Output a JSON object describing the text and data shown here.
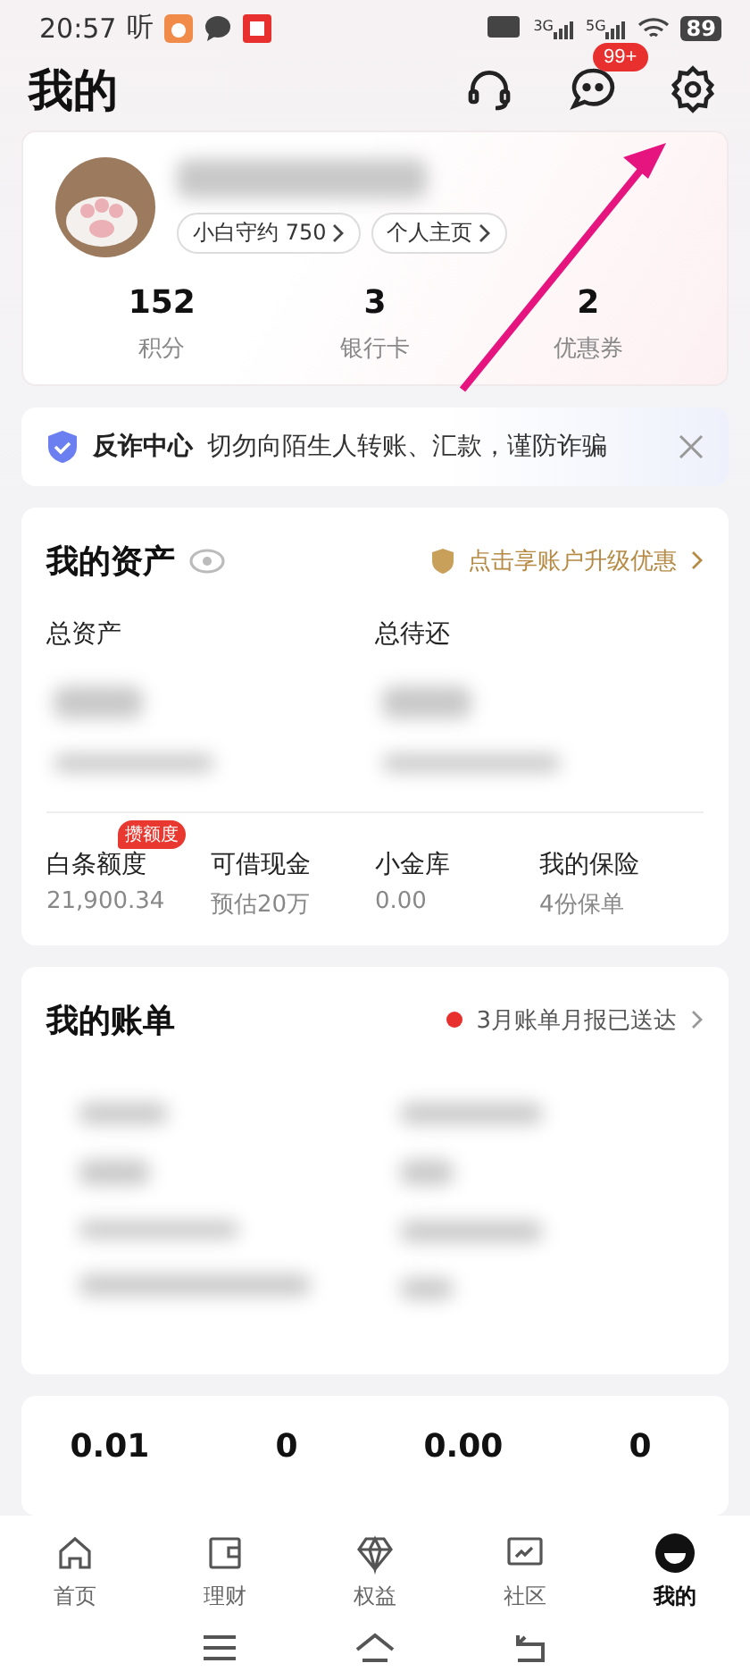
{
  "status_bar": {
    "time": "20:57",
    "notifications": [
      "听"
    ],
    "battery": "89",
    "network": [
      "3G",
      "5G"
    ]
  },
  "header": {
    "title": "我的",
    "message_badge": "99+"
  },
  "profile": {
    "tags": [
      "小白守约 750",
      "个人主页"
    ],
    "stats": [
      {
        "value": "152",
        "label": "积分"
      },
      {
        "value": "3",
        "label": "银行卡"
      },
      {
        "value": "2",
        "label": "优惠券"
      }
    ]
  },
  "notice": {
    "title": "反诈中心",
    "text": "切勿向陌生人转账、汇款，谨防诈骗"
  },
  "assets": {
    "title": "我的资产",
    "promo": "点击享账户升级优惠",
    "totals": [
      "总资产",
      "总待还"
    ],
    "items": [
      {
        "label": "白条额度",
        "value": "21,900.34",
        "badge": "攒额度"
      },
      {
        "label": "可借现金",
        "value": "预估20万"
      },
      {
        "label": "小金库",
        "value": "0.00"
      },
      {
        "label": "我的保险",
        "value": "4份保单"
      }
    ]
  },
  "bills": {
    "title": "我的账单",
    "notice": "3月账单月报已送达"
  },
  "balances": [
    {
      "value": "0.01"
    },
    {
      "value": "0"
    },
    {
      "value": "0.00"
    },
    {
      "value": "0"
    }
  ],
  "tab_bar": [
    {
      "label": "首页",
      "selected": false,
      "kind": "home"
    },
    {
      "label": "理财",
      "selected": false,
      "kind": "wallet"
    },
    {
      "label": "权益",
      "selected": false,
      "kind": "diamond"
    },
    {
      "label": "社区",
      "selected": false,
      "kind": "chart"
    },
    {
      "label": "我的",
      "selected": true,
      "kind": "me"
    }
  ]
}
